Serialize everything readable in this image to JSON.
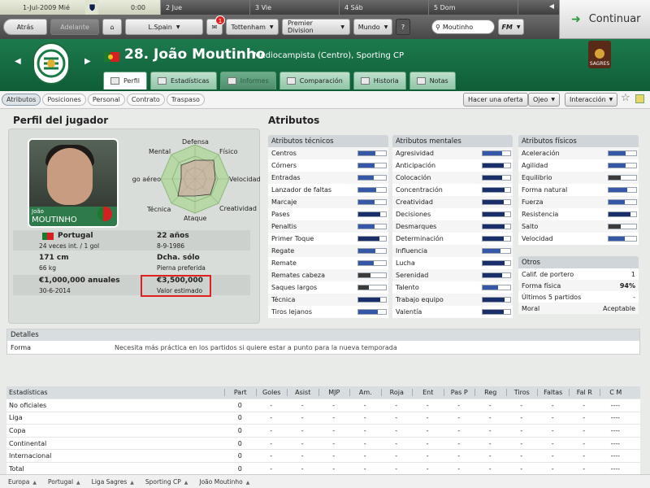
{
  "datebar": {
    "current_date": "1-Jul-2009 Mié",
    "current_time": "0:00",
    "days": [
      "2 Jue",
      "3 Vie",
      "4 Sáb",
      "5 Dom"
    ]
  },
  "nav": {
    "back": "Atrás",
    "forward": "Adelante",
    "nation": "L.Spain",
    "club": "Tottenham",
    "competition": "Premier Division",
    "world": "Mundo",
    "help": "?",
    "search": "Moutinho",
    "fm": "FM",
    "notifications": "1",
    "continue": "Continuar"
  },
  "header": {
    "number_name": "28. João Moutinho",
    "subtitle": "Mediocampista (Centro), Sporting CP",
    "league_logo": "SAGRES",
    "club_crest": "SCP PORTUGAL"
  },
  "tabs": [
    {
      "label": "Perfil",
      "state": "active"
    },
    {
      "label": "Estadísticas",
      "state": "normal"
    },
    {
      "label": "Informes",
      "state": "disabled"
    },
    {
      "label": "Comparación",
      "state": "normal"
    },
    {
      "label": "Historia",
      "state": "normal"
    },
    {
      "label": "Notas",
      "state": "normal"
    }
  ],
  "subtabs": [
    "Atributos",
    "Posiciones",
    "Personal",
    "Contrato",
    "Traspaso"
  ],
  "actions": {
    "offer": "Hacer una oferta",
    "scout": "Ojeo",
    "interaction": "Interacción"
  },
  "profile": {
    "title": "Perfil del jugador",
    "photo_first": "João",
    "photo_last": "MOUTINHO",
    "radar": [
      "Defensa",
      "Físico",
      "Velocidad",
      "Creatividad",
      "Ataque",
      "Técnica",
      "Juego aéreo",
      "Mental"
    ],
    "nationality": "Portugal",
    "caps": "24 veces int. / 1 gol",
    "age": "22 años",
    "dob": "8-9-1986",
    "height": "171 cm",
    "weight": "66 kg",
    "foot": "Dcha. sólo",
    "foot_label": "Pierna preferida",
    "wage": "€1,000,000 anuales",
    "contract_end": "30-6-2014",
    "value": "€3,500,000",
    "value_label": "Valor estimado"
  },
  "attributes": {
    "title": "Atributos",
    "technical": {
      "title": "Atributos técnicos",
      "items": [
        {
          "name": "Centros",
          "v": 0.62,
          "c": "#3557a8"
        },
        {
          "name": "Córners",
          "v": 0.6,
          "c": "#3557a8"
        },
        {
          "name": "Entradas",
          "v": 0.55,
          "c": "#3557a8"
        },
        {
          "name": "Lanzador de faltas",
          "v": 0.65,
          "c": "#3557a8"
        },
        {
          "name": "Marcaje",
          "v": 0.58,
          "c": "#3557a8"
        },
        {
          "name": "Pases",
          "v": 0.78,
          "c": "#1a2f6a"
        },
        {
          "name": "Penaltis",
          "v": 0.6,
          "c": "#3557a8"
        },
        {
          "name": "Primer Toque",
          "v": 0.75,
          "c": "#1a2f6a"
        },
        {
          "name": "Regate",
          "v": 0.62,
          "c": "#3557a8"
        },
        {
          "name": "Remate",
          "v": 0.55,
          "c": "#3557a8"
        },
        {
          "name": "Remates cabeza",
          "v": 0.45,
          "c": "#3b3b3b"
        },
        {
          "name": "Saques largos",
          "v": 0.38,
          "c": "#3b3b3b"
        },
        {
          "name": "Técnica",
          "v": 0.78,
          "c": "#1a2f6a"
        },
        {
          "name": "Tiros lejanos",
          "v": 0.72,
          "c": "#3557a8"
        }
      ]
    },
    "mental": {
      "title": "Atributos mentales",
      "items": [
        {
          "name": "Agresividad",
          "v": 0.7,
          "c": "#3557a8"
        },
        {
          "name": "Anticipación",
          "v": 0.75,
          "c": "#1a2f6a"
        },
        {
          "name": "Colocación",
          "v": 0.72,
          "c": "#1a2f6a"
        },
        {
          "name": "Concentración",
          "v": 0.78,
          "c": "#1a2f6a"
        },
        {
          "name": "Creatividad",
          "v": 0.75,
          "c": "#1a2f6a"
        },
        {
          "name": "Decisiones",
          "v": 0.8,
          "c": "#1a2f6a"
        },
        {
          "name": "Desmarques",
          "v": 0.78,
          "c": "#1a2f6a"
        },
        {
          "name": "Determinación",
          "v": 0.75,
          "c": "#1a2f6a"
        },
        {
          "name": "Influencia",
          "v": 0.65,
          "c": "#3557a8"
        },
        {
          "name": "Lucha",
          "v": 0.78,
          "c": "#1a2f6a"
        },
        {
          "name": "Serenidad",
          "v": 0.72,
          "c": "#1a2f6a"
        },
        {
          "name": "Talento",
          "v": 0.55,
          "c": "#3557a8"
        },
        {
          "name": "Trabajo equipo",
          "v": 0.8,
          "c": "#1a2f6a"
        },
        {
          "name": "Valentía",
          "v": 0.75,
          "c": "#1a2f6a"
        }
      ]
    },
    "physical": {
      "title": "Atributos físicos",
      "items": [
        {
          "name": "Aceleración",
          "v": 0.62,
          "c": "#3557a8"
        },
        {
          "name": "Agilidad",
          "v": 0.62,
          "c": "#3557a8"
        },
        {
          "name": "Equilibrio",
          "v": 0.45,
          "c": "#3b3b3b"
        },
        {
          "name": "Forma natural",
          "v": 0.68,
          "c": "#3557a8"
        },
        {
          "name": "Fuerza",
          "v": 0.6,
          "c": "#3557a8"
        },
        {
          "name": "Resistencia",
          "v": 0.8,
          "c": "#1a2f6a"
        },
        {
          "name": "Salto",
          "v": 0.45,
          "c": "#3b3b3b"
        },
        {
          "name": "Velocidad",
          "v": 0.58,
          "c": "#3557a8"
        }
      ]
    },
    "other": {
      "title": "Otros",
      "items": [
        {
          "name": "Calif. de portero",
          "value": "1"
        },
        {
          "name": "Forma física",
          "value": "94%"
        },
        {
          "name": "Últimos 5 partidos",
          "value": "-"
        },
        {
          "name": "Moral",
          "value": "Aceptable"
        }
      ]
    }
  },
  "details": {
    "title": "Detalles",
    "label": "Forma",
    "text": "Necesita más práctica en los partidos si quiere estar a punto para la nueva temporada"
  },
  "stats": {
    "headers": [
      "Estadísticas",
      "Part",
      "Goles",
      "Asist",
      "MJP",
      "Am.",
      "Roja",
      "Ent",
      "Pas P",
      "Reg",
      "Tiros",
      "Faltas",
      "Fal R",
      "C M"
    ],
    "rows": [
      [
        "No oficiales",
        "0",
        "-",
        "-",
        "-",
        "-",
        "-",
        "-",
        "-",
        "-",
        "-",
        "-",
        "-",
        "----"
      ],
      [
        "Liga",
        "0",
        "-",
        "-",
        "-",
        "-",
        "-",
        "-",
        "-",
        "-",
        "-",
        "-",
        "-",
        "----"
      ],
      [
        "Copa",
        "0",
        "-",
        "-",
        "-",
        "-",
        "-",
        "-",
        "-",
        "-",
        "-",
        "-",
        "-",
        "----"
      ],
      [
        "Continental",
        "0",
        "-",
        "-",
        "-",
        "-",
        "-",
        "-",
        "-",
        "-",
        "-",
        "-",
        "-",
        "----"
      ],
      [
        "Internacional",
        "0",
        "-",
        "-",
        "-",
        "-",
        "-",
        "-",
        "-",
        "-",
        "-",
        "-",
        "-",
        "----"
      ],
      [
        "Total",
        "0",
        "-",
        "-",
        "-",
        "-",
        "-",
        "-",
        "-",
        "-",
        "-",
        "-",
        "-",
        "----"
      ]
    ]
  },
  "footer": [
    "Europa",
    "Portugal",
    "Liga Sagres",
    "Sporting CP",
    "João Moutinho"
  ]
}
